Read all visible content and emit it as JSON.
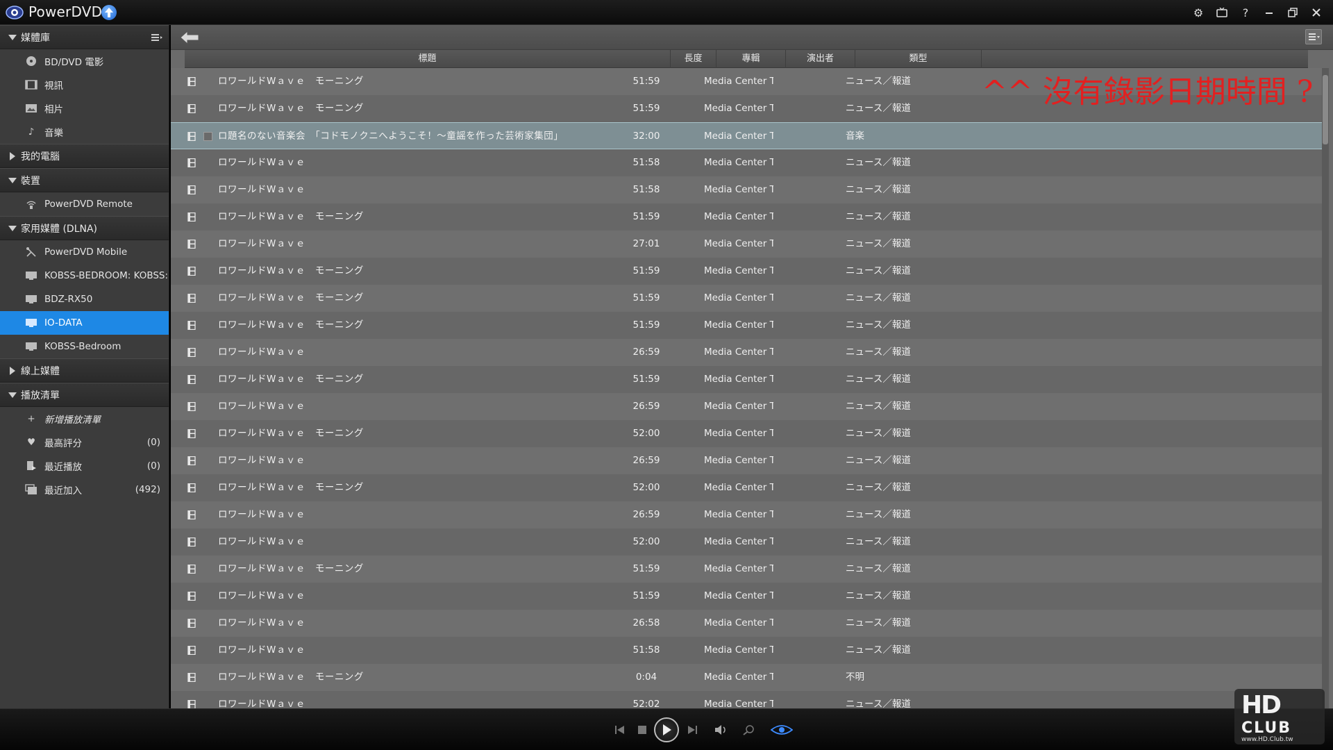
{
  "app": {
    "title": "PowerDVD"
  },
  "sidebar": {
    "sections": [
      {
        "label": "媒體庫",
        "expanded": true,
        "items": [
          {
            "label": "BD/DVD 電影",
            "icon": "disc-icon"
          },
          {
            "label": "視訊",
            "icon": "video-icon"
          },
          {
            "label": "相片",
            "icon": "photo-icon"
          },
          {
            "label": "音樂",
            "icon": "music-note-icon"
          }
        ]
      },
      {
        "label": "我的電腦",
        "expanded": false,
        "items": []
      },
      {
        "label": "裝置",
        "expanded": true,
        "items": [
          {
            "label": "PowerDVD Remote",
            "icon": "remote-icon"
          }
        ]
      },
      {
        "label": "家用媒體 (DLNA)",
        "expanded": true,
        "items": [
          {
            "label": "PowerDVD Mobile",
            "icon": "mobile-icon"
          },
          {
            "label": "KOBSS-BEDROOM: KOBSS:",
            "icon": "monitor-icon"
          },
          {
            "label": "BDZ-RX50",
            "icon": "monitor-icon"
          },
          {
            "label": "IO-DATA",
            "icon": "monitor-icon",
            "active": true
          },
          {
            "label": "KOBSS-Bedroom",
            "icon": "monitor-icon"
          }
        ]
      },
      {
        "label": "線上媒體",
        "expanded": false,
        "items": []
      },
      {
        "label": "播放清單",
        "expanded": true,
        "items": [
          {
            "label": "新增播放清單",
            "icon": "plus-icon",
            "italic": true
          },
          {
            "label": "最高評分",
            "icon": "heart-icon",
            "count": "(0)"
          },
          {
            "label": "最近播放",
            "icon": "recent-icon",
            "count": "(0)"
          },
          {
            "label": "最近加入",
            "icon": "added-icon",
            "count": "(492)"
          }
        ]
      }
    ]
  },
  "table": {
    "columns": {
      "title": "標題",
      "length": "長度",
      "album": "專輯",
      "artist": "演出者",
      "genre": "類型"
    },
    "rows": [
      {
        "title": "ロワールドWａｖｅ　モーニング",
        "length": "51:59",
        "album": "Media Center T",
        "genre": "ニュース／報道"
      },
      {
        "title": "ロワールドWａｖｅ　モーニング",
        "length": "51:59",
        "album": "Media Center T",
        "genre": "ニュース／報道"
      },
      {
        "title": "ロ題名のない音楽会　「コドモノクニへようこそ！～童謡を作った芸術家集団」",
        "length": "32:00",
        "album": "Media Center T",
        "genre": "音楽",
        "selected": true
      },
      {
        "title": "ロワールドWａｖｅ",
        "length": "51:58",
        "album": "Media Center T",
        "genre": "ニュース／報道"
      },
      {
        "title": "ロワールドWａｖｅ",
        "length": "51:58",
        "album": "Media Center T",
        "genre": "ニュース／報道"
      },
      {
        "title": "ロワールドWａｖｅ　モーニング",
        "length": "51:59",
        "album": "Media Center T",
        "genre": "ニュース／報道"
      },
      {
        "title": "ロワールドWａｖｅ",
        "length": "27:01",
        "album": "Media Center T",
        "genre": "ニュース／報道"
      },
      {
        "title": "ロワールドWａｖｅ　モーニング",
        "length": "51:59",
        "album": "Media Center T",
        "genre": "ニュース／報道"
      },
      {
        "title": "ロワールドWａｖｅ　モーニング",
        "length": "51:59",
        "album": "Media Center T",
        "genre": "ニュース／報道"
      },
      {
        "title": "ロワールドWａｖｅ　モーニング",
        "length": "51:59",
        "album": "Media Center T",
        "genre": "ニュース／報道"
      },
      {
        "title": "ロワールドWａｖｅ",
        "length": "26:59",
        "album": "Media Center T",
        "genre": "ニュース／報道"
      },
      {
        "title": "ロワールドWａｖｅ　モーニング",
        "length": "51:59",
        "album": "Media Center T",
        "genre": "ニュース／報道"
      },
      {
        "title": "ロワールドWａｖｅ",
        "length": "26:59",
        "album": "Media Center T",
        "genre": "ニュース／報道"
      },
      {
        "title": "ロワールドWａｖｅ　モーニング",
        "length": "52:00",
        "album": "Media Center T",
        "genre": "ニュース／報道"
      },
      {
        "title": "ロワールドWａｖｅ",
        "length": "26:59",
        "album": "Media Center T",
        "genre": "ニュース／報道"
      },
      {
        "title": "ロワールドWａｖｅ　モーニング",
        "length": "52:00",
        "album": "Media Center T",
        "genre": "ニュース／報道"
      },
      {
        "title": "ロワールドWａｖｅ",
        "length": "26:59",
        "album": "Media Center T",
        "genre": "ニュース／報道"
      },
      {
        "title": "ロワールドWａｖｅ",
        "length": "52:00",
        "album": "Media Center T",
        "genre": "ニュース／報道"
      },
      {
        "title": "ロワールドWａｖｅ　モーニング",
        "length": "51:59",
        "album": "Media Center T",
        "genre": "ニュース／報道"
      },
      {
        "title": "ロワールドWａｖｅ",
        "length": "51:59",
        "album": "Media Center T",
        "genre": "ニュース／報道"
      },
      {
        "title": "ロワールドWａｖｅ",
        "length": "26:58",
        "album": "Media Center T",
        "genre": "ニュース／報道"
      },
      {
        "title": "ロワールドWａｖｅ",
        "length": "51:58",
        "album": "Media Center T",
        "genre": "ニュース／報道"
      },
      {
        "title": "ロワールドWａｖｅ　モーニング",
        "length": "0:04",
        "album": "Media Center T",
        "genre": "不明"
      },
      {
        "title": "ロワールドWａｖｅ",
        "length": "52:02",
        "album": "Media Center T",
        "genre": "ニュース／報道"
      }
    ]
  },
  "annotation": {
    "text": "^^ 沒有錄影日期時間 ?"
  },
  "watermark": {
    "logo": "HD",
    "sub": "CLUB",
    "url": "www.HD.Club.tw"
  },
  "colors": {
    "accent": "#1e88e5",
    "annotation": "#e22020"
  }
}
